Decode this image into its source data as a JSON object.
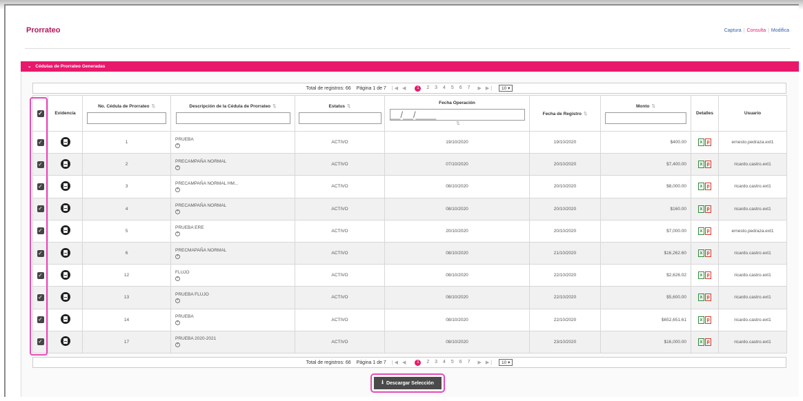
{
  "header": {
    "title": "Prorrateo",
    "links": [
      {
        "label": "Captura",
        "active": false
      },
      {
        "label": "Consulta",
        "active": true
      },
      {
        "label": "Modifica",
        "active": false
      }
    ]
  },
  "panel": {
    "title": "Cédulas de Prorrateo Generadas"
  },
  "pager": {
    "total_label": "Total de registros: 66",
    "page_label": "Página 1 de 7",
    "current_page": "1",
    "pages": [
      "2",
      "3",
      "4",
      "5",
      "6",
      "7"
    ],
    "rows_per_page": "10"
  },
  "columns": {
    "evidence": "Evidencia",
    "number": "No. Cédula de Prorrateo",
    "description": "Descripción de la Cédula de Prorrateo",
    "status": "Estatus",
    "op_date": "Fecha Operación",
    "op_date_placeholder": "__/__/____",
    "reg_date": "Fecha de Registro",
    "amount": "Monto",
    "details": "Detalles",
    "user": "Usuario"
  },
  "rows": [
    {
      "num": "1",
      "desc": "PRUEBA",
      "status": "ACTIVO",
      "op_date": "19/10/2020",
      "reg_date": "19/10/2020",
      "amount": "$400.00",
      "user": "ernesto.pedraza.ext1"
    },
    {
      "num": "2",
      "desc": "PRECAMPAÑA NORMAL",
      "status": "ACTIVO",
      "op_date": "07/10/2020",
      "reg_date": "20/10/2020",
      "amount": "$7,400.00",
      "user": "ricardo.castro.ext1"
    },
    {
      "num": "3",
      "desc": "PRECAMPAÑA NORMAL HM...",
      "status": "ACTIVO",
      "op_date": "08/10/2020",
      "reg_date": "20/10/2020",
      "amount": "$8,000.00",
      "user": "ricardo.castro.ext1"
    },
    {
      "num": "4",
      "desc": "PRECAMPAÑA NORMAL",
      "status": "ACTIVO",
      "op_date": "08/10/2020",
      "reg_date": "20/10/2020",
      "amount": "$160.00",
      "user": "ricardo.castro.ext1"
    },
    {
      "num": "5",
      "desc": "PRUEBA ERE",
      "status": "ACTIVO",
      "op_date": "20/10/2020",
      "reg_date": "20/10/2020",
      "amount": "$7,000.00",
      "user": "ernesto.pedraza.ext1"
    },
    {
      "num": "6",
      "desc": "PRECMAPAÑA NORMAL",
      "status": "ACTIVO",
      "op_date": "08/10/2020",
      "reg_date": "21/10/2020",
      "amount": "$16,262.60",
      "user": "ricardo.castro.ext1"
    },
    {
      "num": "12",
      "desc": "FLUJO",
      "status": "ACTIVO",
      "op_date": "08/10/2020",
      "reg_date": "22/10/2020",
      "amount": "$2,626.02",
      "user": "ricardo.castro.ext1"
    },
    {
      "num": "13",
      "desc": "PRUEBA FLUJO",
      "status": "ACTIVO",
      "op_date": "08/10/2020",
      "reg_date": "22/10/2020",
      "amount": "$5,600.00",
      "user": "ricardo.castro.ext1"
    },
    {
      "num": "14",
      "desc": "PRUEBA",
      "status": "ACTIVO",
      "op_date": "08/10/2020",
      "reg_date": "22/10/2020",
      "amount": "$652,651.61",
      "user": "ricardo.castro.ext1"
    },
    {
      "num": "17",
      "desc": "PRUEBA 2020-2021",
      "status": "ACTIVO",
      "op_date": "08/10/2020",
      "reg_date": "23/10/2020",
      "amount": "$16,000.00",
      "user": "ricardo.castro.ext1"
    }
  ],
  "download": {
    "label": "Descargar Selección"
  },
  "colors": {
    "accent": "#e8196b",
    "title": "#b0175a",
    "highlight": "#e64bb6"
  }
}
